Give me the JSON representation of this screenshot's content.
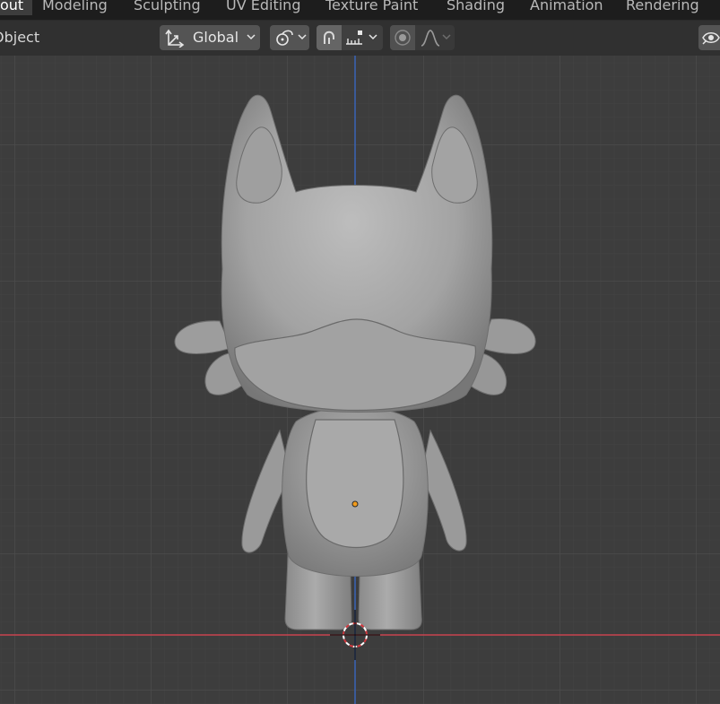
{
  "workspace_tabs": [
    {
      "label": "out"
    },
    {
      "label": "Modeling"
    },
    {
      "label": "Sculpting"
    },
    {
      "label": "UV Editing"
    },
    {
      "label": "Texture Paint"
    },
    {
      "label": "Shading"
    },
    {
      "label": "Animation"
    },
    {
      "label": "Rendering"
    }
  ],
  "header": {
    "mode_label": "Object",
    "transform_orientation": "Global"
  },
  "icons": {
    "orientation": "transform-axes-icon",
    "pivot": "pivot-link-icon",
    "snap": "magnet-snap-icon",
    "snap_target": "snap-increment-icon",
    "proportional": "proportional-edit-icon",
    "falloff": "falloff-curve-icon",
    "visibility": "eye-visibility-icon"
  },
  "colors": {
    "viewport_bg": "#3d3d3d",
    "x_axis": "#c8434f",
    "z_axis": "#3a62b0",
    "origin_dot": "#f29b1a",
    "model": "#9a9a9a"
  }
}
